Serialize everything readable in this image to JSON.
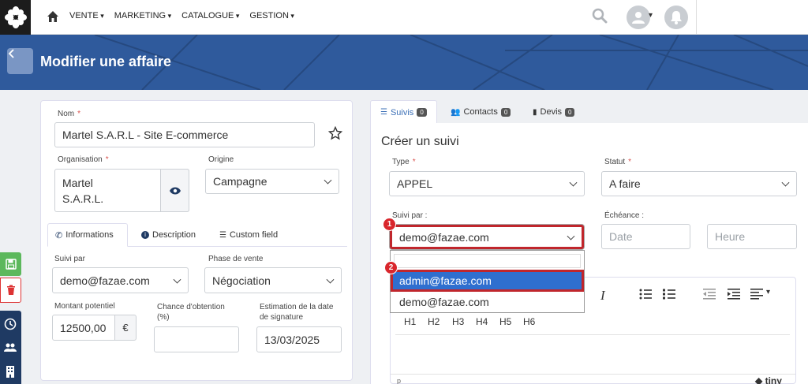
{
  "nav": {
    "items": [
      {
        "label": "VENTE"
      },
      {
        "label": "MARKETING"
      },
      {
        "label": "CATALOGUE"
      },
      {
        "label": "GESTION"
      }
    ]
  },
  "page": {
    "title": "Modifier une affaire"
  },
  "left": {
    "nom_label": "Nom",
    "nom_value": "Martel S.A.R.L - Site E-commerce",
    "organisation_label": "Organisation",
    "organisation_value_line1": "Martel",
    "organisation_value_line2": "S.A.R.L.",
    "origine_label": "Origine",
    "origine_value": "Campagne",
    "tabs": [
      {
        "label": "Informations"
      },
      {
        "label": "Description"
      },
      {
        "label": "Custom field"
      }
    ],
    "suivi_label": "Suivi par",
    "suivi_value": "demo@fazae.com",
    "phase_label": "Phase de vente",
    "phase_value": "Négociation",
    "montant_label": "Montant potentiel",
    "montant_value": "12500,00",
    "currency": "€",
    "chance_label_line1": "Chance d'obtention",
    "chance_label_line2": "(%)",
    "chance_value": "",
    "estimation_label_line1": "Estimation de la date",
    "estimation_label_line2": "de signature",
    "estimation_value": "13/03/2025"
  },
  "right": {
    "tabs": [
      {
        "label": "Suivis",
        "count": "0"
      },
      {
        "label": "Contacts",
        "count": "0"
      },
      {
        "label": "Devis",
        "count": "0"
      }
    ],
    "title": "Créer un suivi",
    "type_label": "Type",
    "type_value": "APPEL",
    "statut_label": "Statut",
    "statut_value": "A faire",
    "suivi_label": "Suivi par :",
    "suivi_value": "demo@fazae.com",
    "echeance_label": "Échéance :",
    "date_placeholder": "Date",
    "heure_placeholder": "Heure",
    "dropdown_options": [
      "admin@fazae.com",
      "demo@fazae.com"
    ],
    "step1": "1",
    "step2": "2",
    "headings": [
      "H1",
      "H2",
      "H3",
      "H4",
      "H5",
      "H6"
    ],
    "editor_footer_left": "p",
    "editor_footer_right": "tiny"
  },
  "colors": {
    "brand": "#2f5a9c",
    "accent": "#2f6fcf",
    "highlight": "#d9262c"
  }
}
